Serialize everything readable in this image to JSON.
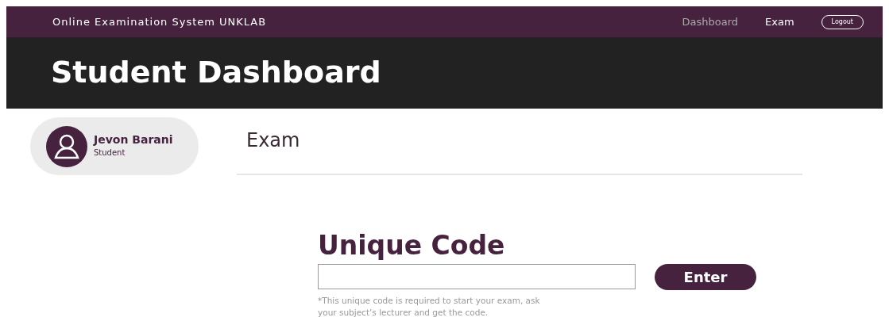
{
  "navbar": {
    "brand": "Online Examination System UNKLAB",
    "links": [
      {
        "label": "Dashboard",
        "selected": false
      },
      {
        "label": "Exam",
        "selected": true
      }
    ],
    "logout": "Logout"
  },
  "header": {
    "title": "Student Dashboard"
  },
  "profile": {
    "name": "Jevon Barani",
    "role": "Student"
  },
  "section": {
    "title": "Exam"
  },
  "code_form": {
    "title": "Unique Code",
    "button": "Enter",
    "note": "*This unique code is required to start your exam, ask your subject’s lecturer and get the code."
  }
}
